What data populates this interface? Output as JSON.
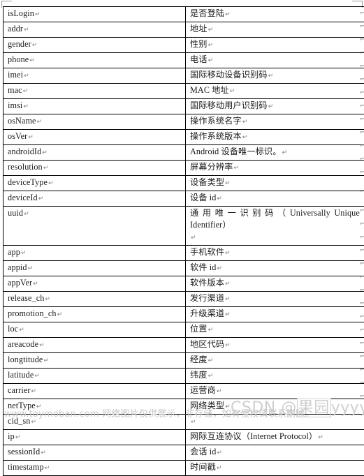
{
  "document": {
    "type": "word-table",
    "columns": 2,
    "rows": [
      {
        "key": "isLogin",
        "value": "是否登陆",
        "value_lang": "cn"
      },
      {
        "key": "addr",
        "value": "地址",
        "value_lang": "cn"
      },
      {
        "key": "gender",
        "value": "性别",
        "value_lang": "cn"
      },
      {
        "key": "phone",
        "value": "电话",
        "value_lang": "cn"
      },
      {
        "key": "imei",
        "value": "国际移动设备识别码",
        "value_lang": "cn"
      },
      {
        "key": "mac",
        "value": "MAC 地址",
        "value_lang": "mixed"
      },
      {
        "key": "imsi",
        "value": "国际移动用户识别码",
        "value_lang": "cn"
      },
      {
        "key": "osName",
        "value": "操作系统名字",
        "value_lang": "cn"
      },
      {
        "key": "osVer",
        "value": "操作系统版本",
        "value_lang": "cn"
      },
      {
        "key": "androidId",
        "value": "Android 设备唯一标识。",
        "value_lang": "mixed"
      },
      {
        "key": "resolution",
        "value": "屏幕分辨率",
        "value_lang": "cn"
      },
      {
        "key": "deviceType",
        "value": "设备类型",
        "value_lang": "cn"
      },
      {
        "key": "deviceId",
        "value": "设备 id",
        "value_lang": "mixed"
      },
      {
        "key": "uuid",
        "value": "通 用 唯 一 识 别 码 （Universally Unique Identifier）",
        "value_lang": "mixed",
        "multiline": true,
        "line1_chars": [
          "通",
          "用",
          "唯",
          "一",
          "识",
          "别",
          "码",
          "（",
          "Universally",
          "Unique"
        ],
        "line2": "Identifier）"
      },
      {
        "key": "app",
        "value": "手机软件",
        "value_lang": "cn"
      },
      {
        "key": "appid",
        "value": "软件 id",
        "value_lang": "mixed"
      },
      {
        "key": "appVer",
        "value": "软件版本",
        "value_lang": "cn"
      },
      {
        "key": "release_ch",
        "value": "发行渠道",
        "value_lang": "cn"
      },
      {
        "key": "promotion_ch",
        "value": "升级渠道",
        "value_lang": "cn"
      },
      {
        "key": "loc",
        "value": "位置",
        "value_lang": "cn"
      },
      {
        "key": "areacode",
        "value": "地区代码",
        "value_lang": "cn"
      },
      {
        "key": "longtitude",
        "value": "经度",
        "value_lang": "cn"
      },
      {
        "key": "latitude",
        "value": "纬度",
        "value_lang": "cn"
      },
      {
        "key": "carrier",
        "value": "运营商",
        "value_lang": "cn"
      },
      {
        "key": "netType",
        "value": "网络类型",
        "value_lang": "cn"
      },
      {
        "key": "cid_sn",
        "value": "",
        "value_lang": "cn"
      },
      {
        "key": "ip",
        "value": "网际互连协议（Internet Protocol）",
        "value_lang": "mixed"
      },
      {
        "key": "sessionId",
        "value": "会话 id",
        "value_lang": "mixed"
      },
      {
        "key": "timestamp",
        "value": "时间戳",
        "value_lang": "cn"
      }
    ]
  },
  "marks": {
    "paragraph_mark": "↵"
  },
  "watermarks": {
    "csdn_prefix": "CSDN ",
    "csdn_at": "@",
    "csdn_boxed": "果园",
    "csdn_suffix": "yyyyyyy",
    "bottom_url": "www.toymoban.com",
    "bottom_notice": "网络图片仅供展示，非存储，如有侵权请联系删除。"
  },
  "colors": {
    "border": "#000000",
    "text": "#1b1b1b",
    "mark": "#7d7d7d",
    "watermark": "#cfcfcf",
    "background": "#ffffff"
  }
}
